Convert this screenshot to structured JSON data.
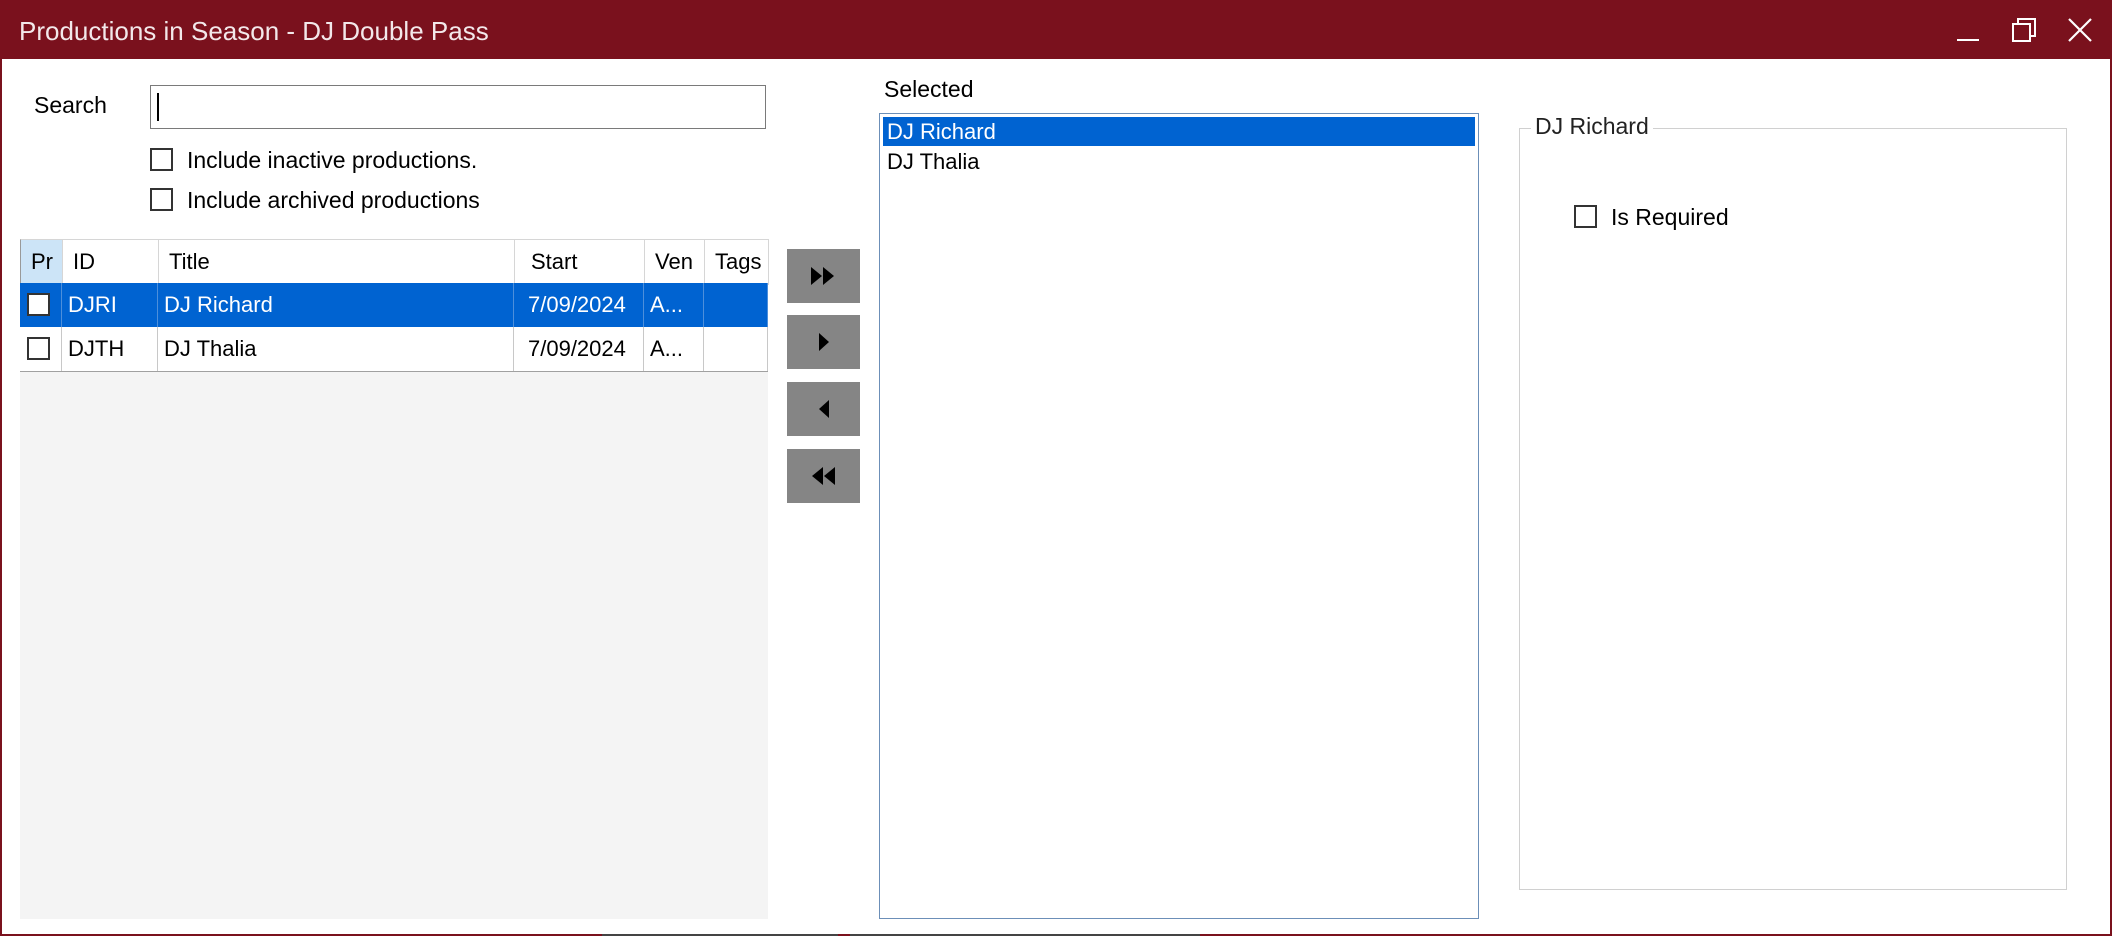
{
  "window": {
    "title": "Productions in Season - DJ Double Pass",
    "accent_color": "#7a111d",
    "controls": [
      "minimize-icon",
      "maximize-icon",
      "close-icon"
    ]
  },
  "search": {
    "label": "Search",
    "value": "",
    "placeholder": ""
  },
  "filters": {
    "inactive_label": "Include inactive productions.",
    "inactive_checked": false,
    "archived_label": "Include archived productions",
    "archived_checked": false
  },
  "grid": {
    "columns": [
      "Pr",
      "ID",
      "Title",
      "Start",
      "Ven",
      "Tags"
    ],
    "rows": [
      {
        "checked": false,
        "id": "DJRI",
        "title": "DJ Richard",
        "start": "7/09/2024",
        "venue": "A...",
        "tags": "",
        "selected": true
      },
      {
        "checked": false,
        "id": "DJTH",
        "title": "DJ Thalia",
        "start": "7/09/2024",
        "venue": "A...",
        "tags": "",
        "selected": false
      }
    ]
  },
  "move_buttons": [
    "move-all-right-icon",
    "move-right-icon",
    "move-left-icon",
    "move-all-left-icon"
  ],
  "selected_panel": {
    "label": "Selected",
    "items": [
      "DJ Richard",
      "DJ Thalia"
    ],
    "selected_index": 0
  },
  "details": {
    "group_title": "DJ Richard",
    "is_required_label": "Is Required",
    "is_required_checked": false
  }
}
